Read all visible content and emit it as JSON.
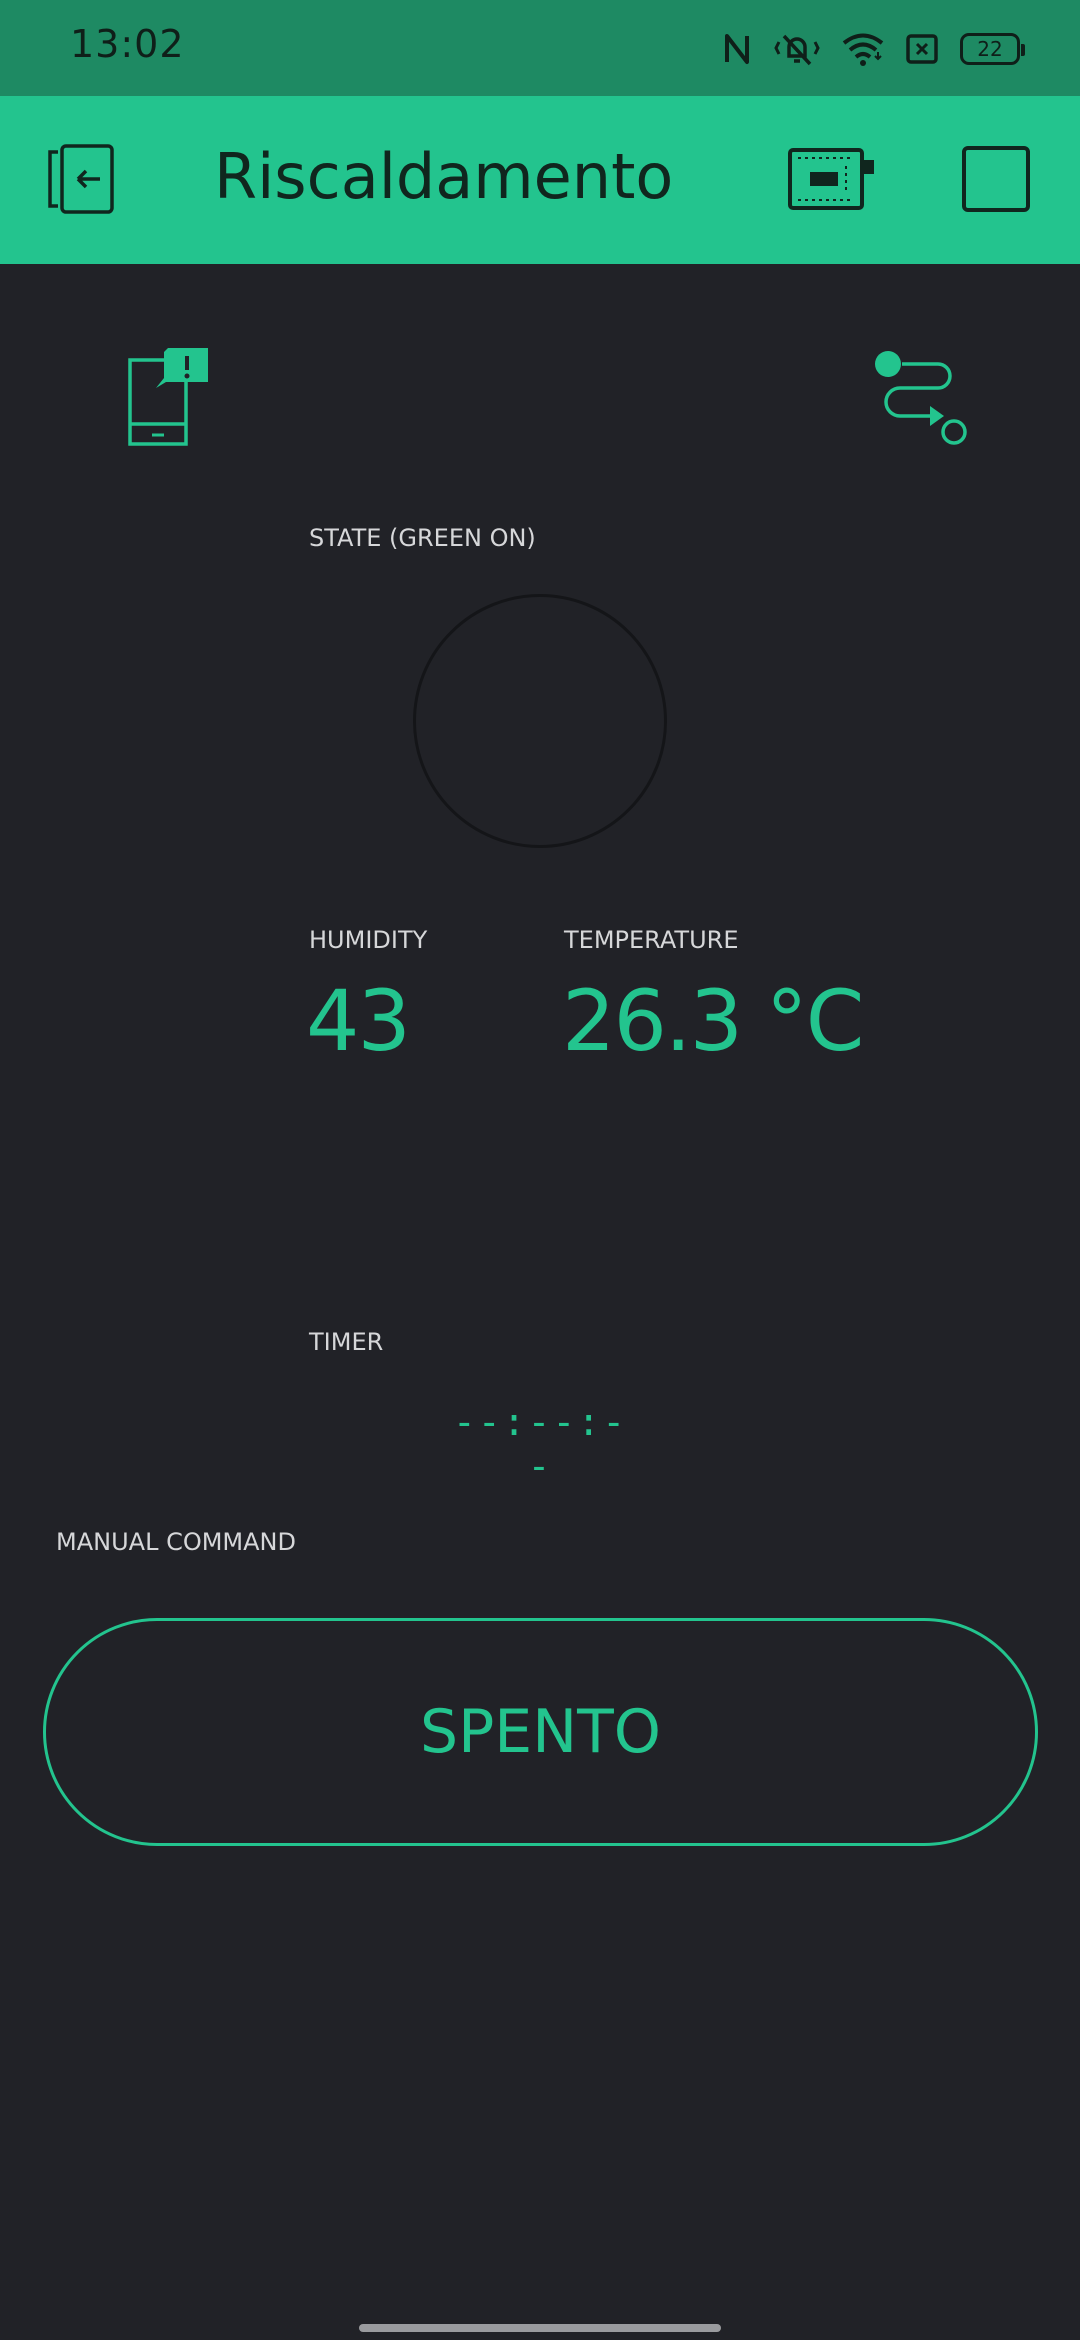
{
  "status_bar": {
    "time": "13:02",
    "battery_level": "22",
    "icons": [
      "nfc-icon",
      "silent-vibrate-icon",
      "wifi-icon",
      "sim-off-icon",
      "battery-icon"
    ]
  },
  "app_bar": {
    "title": "Riscaldamento",
    "background_color": "#23c48e",
    "icons": [
      "exit-icon",
      "device-board-icon",
      "square-icon"
    ]
  },
  "widgets": {
    "notification_icon": "phone-notification-icon",
    "eventor_icon": "route-icon",
    "state": {
      "label": "STATE (GREEN ON)",
      "led_on": false
    },
    "humidity": {
      "label": "HUMIDITY",
      "value": "43"
    },
    "temperature": {
      "label": "TEMPERATURE",
      "value": "26.3 °C"
    },
    "timer": {
      "label": "TIMER",
      "value": "--:--:--"
    },
    "manual": {
      "label": "MANUAL COMMAND",
      "button_label": "SPENTO"
    }
  },
  "colors": {
    "accent": "#23c48e",
    "status_bar": "#1e8a63",
    "background": "#212227",
    "label": "#d6d7d9"
  }
}
